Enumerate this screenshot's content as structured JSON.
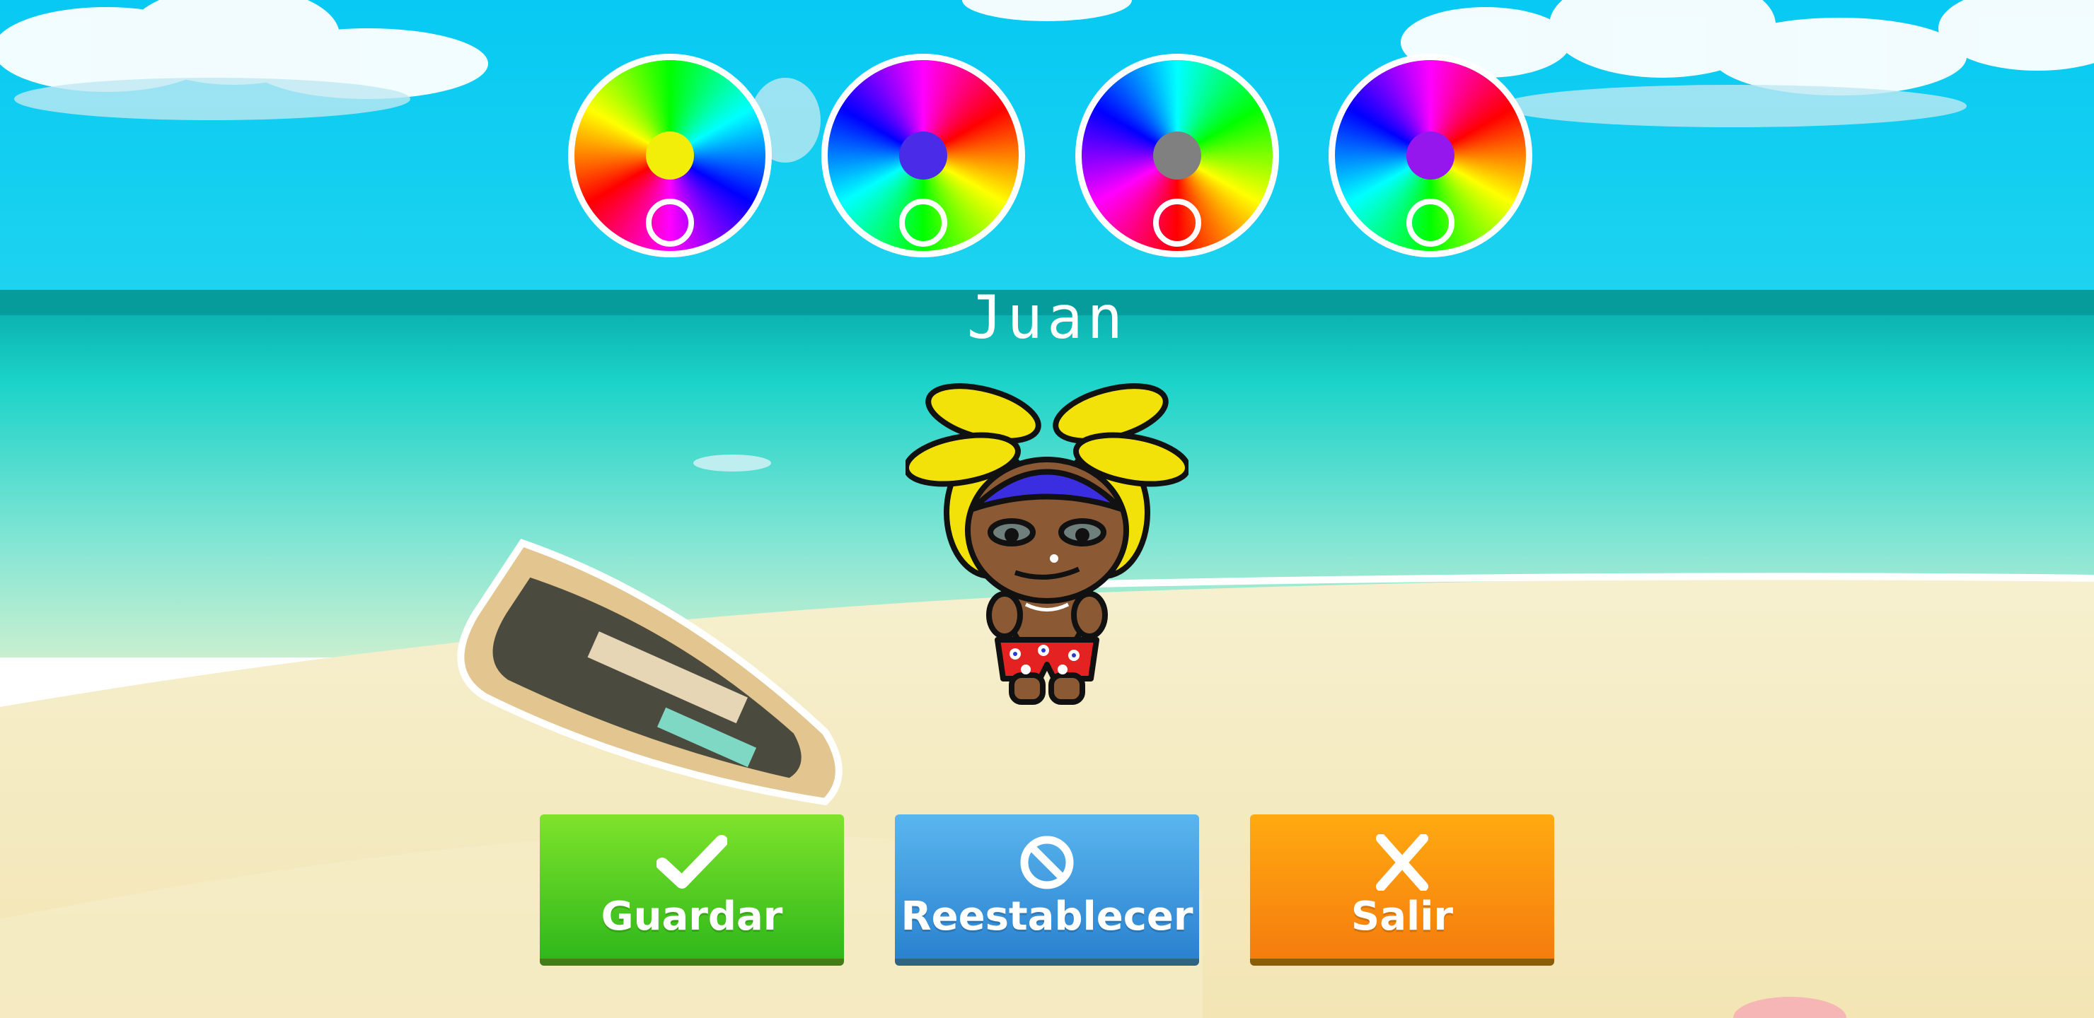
{
  "player": {
    "name": "Juan"
  },
  "color_wheels": [
    {
      "name": "hair-color-wheel",
      "selected_color": "#f2ee0a"
    },
    {
      "name": "band-color-wheel",
      "selected_color": "#4a2be8"
    },
    {
      "name": "skin-color-wheel",
      "selected_color": "#808080"
    },
    {
      "name": "shorts-color-wheel",
      "selected_color": "#9616ee"
    }
  ],
  "buttons": {
    "save_label": "Guardar",
    "reset_label": "Reestablecer",
    "exit_label": "Salir"
  },
  "icons": {
    "save": "checkmark-icon",
    "reset": "prohibited-icon",
    "exit": "close-x-icon"
  }
}
